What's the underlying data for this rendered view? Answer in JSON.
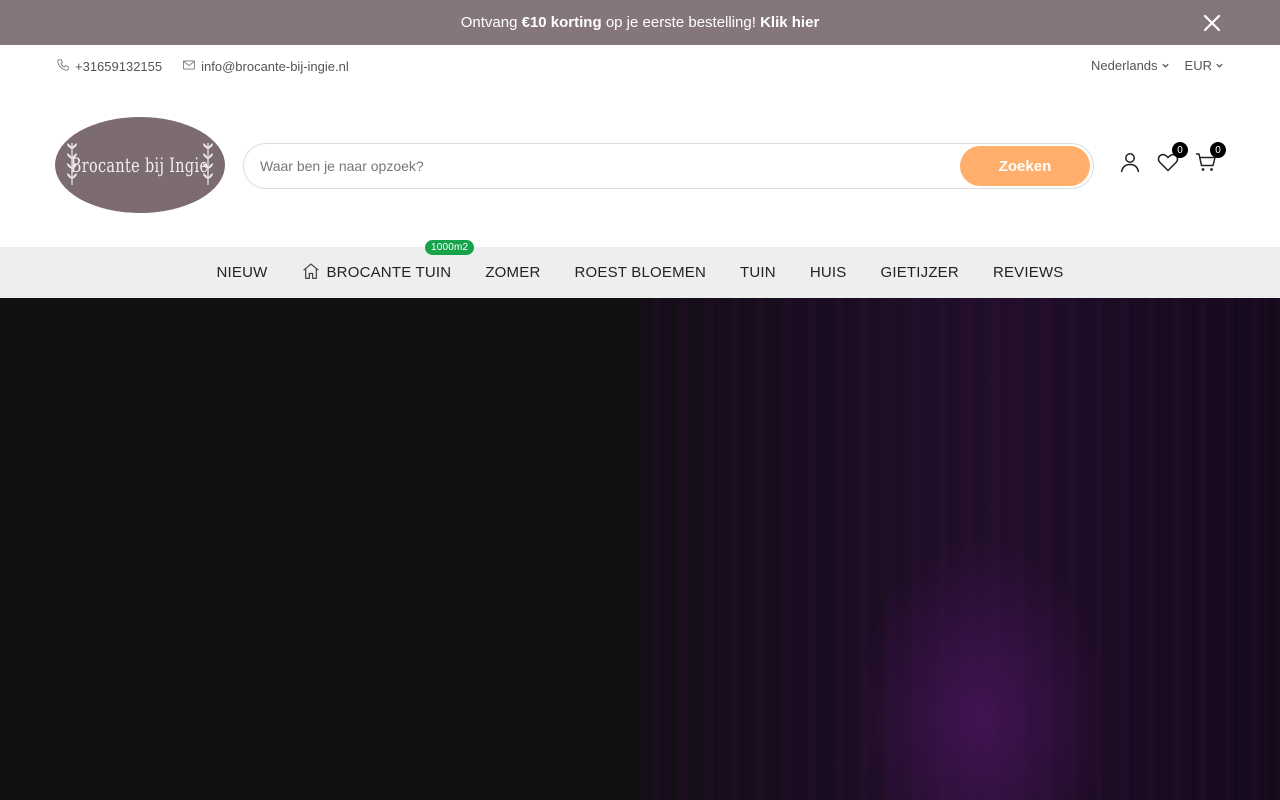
{
  "announcement": {
    "prefix": "Ontvang",
    "highlight": "€10 korting",
    "middle": "op je eerste bestelling!",
    "link": "Klik hier"
  },
  "topbar": {
    "phone": "+31659132155",
    "email": "info@brocante-bij-ingie.nl",
    "language": "Nederlands",
    "currency": "EUR"
  },
  "logo": {
    "text": "Brocante bij Ingie"
  },
  "search": {
    "placeholder": "Waar ben je naar opzoek?",
    "button": "Zoeken"
  },
  "header_icons": {
    "wishlist_count": "0",
    "cart_count": "0"
  },
  "nav": {
    "items": [
      {
        "label": "NIEUW"
      },
      {
        "label": "BROCANTE TUIN",
        "tag": "1000m2"
      },
      {
        "label": "ZOMER"
      },
      {
        "label": "ROEST BLOEMEN"
      },
      {
        "label": "TUIN"
      },
      {
        "label": "HUIS"
      },
      {
        "label": "GIETIJZER"
      },
      {
        "label": "REVIEWS"
      }
    ]
  },
  "colors": {
    "announcement_bg": "#85757c",
    "search_button": "#ffae6b",
    "nav_bg": "#ecefee",
    "tag_bg": "#16a34a",
    "logo_bg": "#7c6c72"
  }
}
